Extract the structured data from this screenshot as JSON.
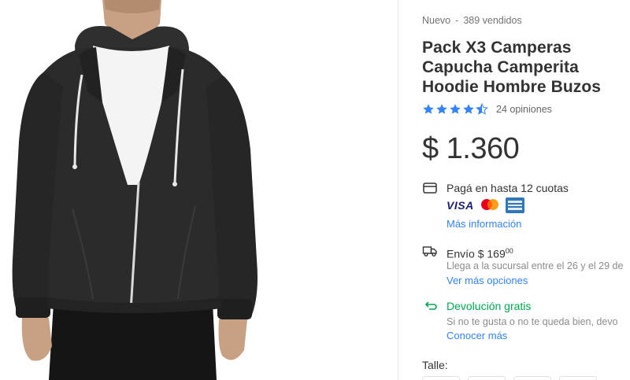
{
  "product": {
    "condition": "Nuevo",
    "separator": "-",
    "sold": "389 vendidos",
    "title": "Pack X3 Camperas Capucha Camperita Hoodie Hombre Buzos",
    "rating": 4.5,
    "reviews": "24 opiniones",
    "currency": "$",
    "price": "1.360"
  },
  "payment": {
    "label": "Pagá en hasta 12 cuotas",
    "cards": [
      "VISA",
      "mastercard",
      "american-express"
    ],
    "more": "Más información"
  },
  "shipping": {
    "label": "Envío $ 169",
    "cents": "00",
    "detail": "Llega a la sucursal entre el 26 y el 29 de",
    "more": "Ver más opciones"
  },
  "returns": {
    "label": "Devolución gratis",
    "detail": "Si no te gusta o no te queda bien, devo",
    "more": "Conocer más"
  },
  "size": {
    "label": "Talle:"
  },
  "colors": {
    "link": "#3483fa",
    "green": "#00a650",
    "star": "#3483fa",
    "hoodie": "#2b2b2b"
  }
}
